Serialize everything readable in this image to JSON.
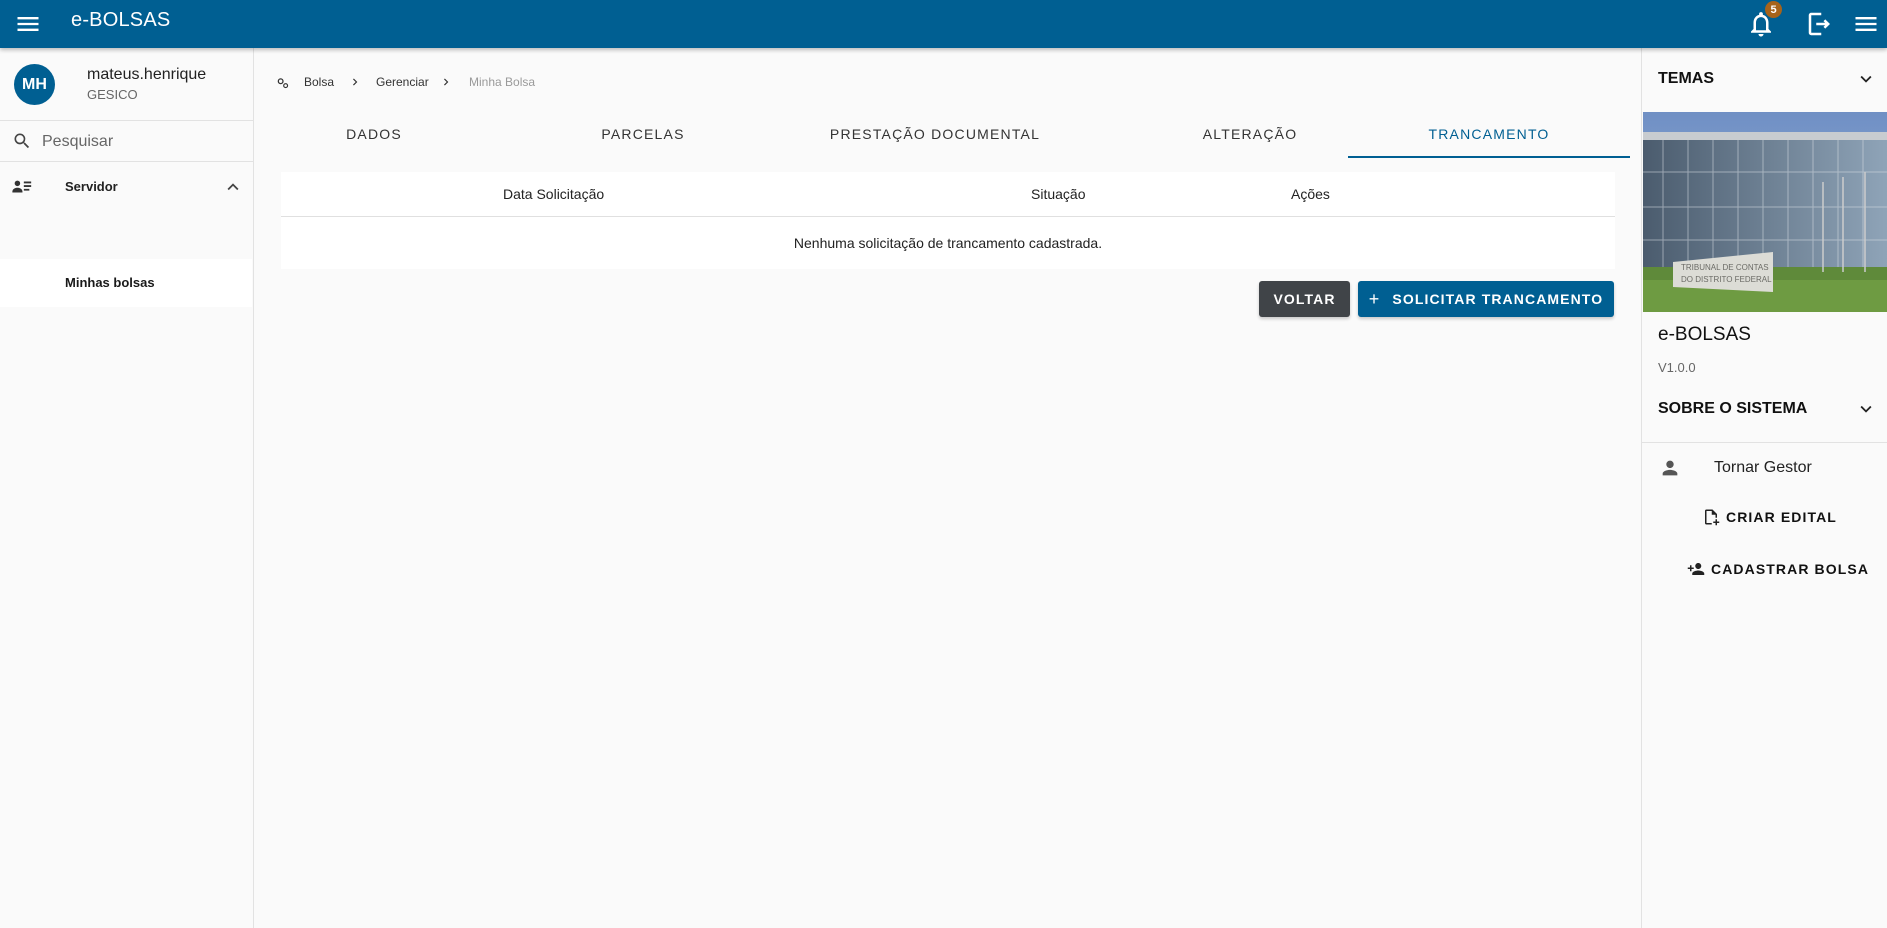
{
  "header": {
    "app_title": "e-BOLSAS",
    "notification_count": "5",
    "brand_color": "#005f92",
    "menu_icon": "menu-icon",
    "notifications_icon": "bell-icon",
    "logout_icon": "logout-icon",
    "right_menu_icon": "menu-icon"
  },
  "sidebar": {
    "user": {
      "initials": "MH",
      "name": "mateus.henrique",
      "org": "GESICO"
    },
    "search": {
      "placeholder": "Pesquisar",
      "value": ""
    },
    "group": {
      "label": "Servidor",
      "icon": "person-list-icon",
      "expanded": true
    },
    "items": [
      {
        "label": "Minhas bolsas",
        "active": true
      }
    ]
  },
  "breadcrumb": {
    "icon": "settings-icon",
    "items": [
      "Bolsa",
      "Gerenciar",
      "Minha Bolsa"
    ]
  },
  "tabs": [
    {
      "label": "DADOS",
      "active": false
    },
    {
      "label": "PARCELAS",
      "active": false
    },
    {
      "label": "PRESTAÇÃO DOCUMENTAL",
      "active": false
    },
    {
      "label": "ALTERAÇÃO",
      "active": false
    },
    {
      "label": "TRANCAMENTO",
      "active": true
    }
  ],
  "table": {
    "columns": [
      "Data Solicitação",
      "Situação",
      "Ações"
    ],
    "empty_message": "Nenhuma solicitação de trancamento cadastrada."
  },
  "actions": {
    "back_label": "VOLTAR",
    "primary_label": "SOLICITAR TRANCAMENTO",
    "primary_icon": "plus-icon"
  },
  "right_panel": {
    "themes_label": "TEMAS",
    "app_name": "e-BOLSAS",
    "version": "V1.0.0",
    "about_label": "SOBRE O SISTEMA",
    "become_manager_label": "Tornar Gestor",
    "create_notice_label": "CRIAR EDITAL",
    "register_grant_label": "CADASTRAR BOLSA",
    "image_sign_line1": "TRIBUNAL DE CONTAS",
    "image_sign_line2": "DO DISTRITO FEDERAL"
  }
}
